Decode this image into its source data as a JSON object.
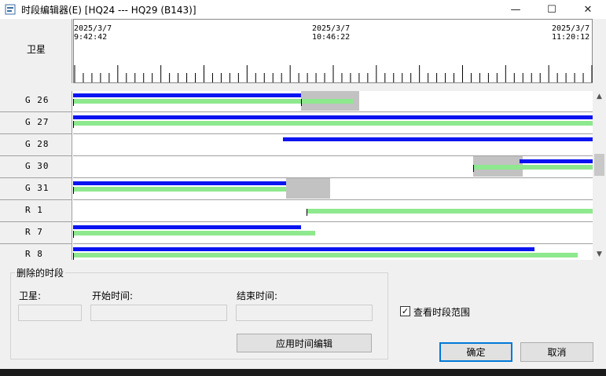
{
  "window": {
    "title": "时段编辑器(E) [HQ24 --- HQ29 (B143)]",
    "controls": {
      "minimize": "—",
      "maximize": "☐",
      "close": "✕"
    }
  },
  "header": {
    "satellite_column": "卫星"
  },
  "timeline": {
    "start": {
      "date": "2025/3/7",
      "time": "9:42:42"
    },
    "mid": {
      "date": "2025/3/7",
      "time": "10:46:22"
    },
    "end": {
      "date": "2025/3/7",
      "time": "11:20:12"
    }
  },
  "satellites": [
    {
      "label": "G 26",
      "blue": [
        [
          9.42,
          10.2
        ]
      ],
      "green": [
        [
          9.42,
          10.2
        ],
        [
          10.2,
          10.38
        ]
      ],
      "hatch": [
        [
          10.2,
          10.4
        ]
      ]
    },
    {
      "label": "G 27",
      "blue": [
        [
          9.42,
          11.2
        ]
      ],
      "green": [
        [
          9.42,
          11.2
        ]
      ],
      "hatch": []
    },
    {
      "label": "G 28",
      "blue": [
        [
          10.14,
          11.2
        ]
      ],
      "green": [],
      "hatch": []
    },
    {
      "label": "G 30",
      "blue": [
        [
          10.95,
          11.2
        ]
      ],
      "green": [
        [
          10.79,
          11.2
        ]
      ],
      "hatch": [
        [
          10.79,
          10.96
        ]
      ]
    },
    {
      "label": "G 31",
      "blue": [
        [
          9.42,
          10.15
        ]
      ],
      "green": [
        [
          9.42,
          10.15
        ]
      ],
      "hatch": [
        [
          10.15,
          10.3
        ]
      ]
    },
    {
      "label": "R 1",
      "blue": [],
      "green": [
        [
          10.22,
          11.2
        ]
      ],
      "hatch": []
    },
    {
      "label": "R 7",
      "blue": [
        [
          9.42,
          10.2
        ]
      ],
      "green": [
        [
          9.42,
          10.25
        ]
      ],
      "hatch": []
    },
    {
      "label": "R 8",
      "blue": [
        [
          9.42,
          11.0
        ]
      ],
      "green": [
        [
          9.42,
          11.15
        ]
      ],
      "hatch": []
    }
  ],
  "delete_panel": {
    "title": "删除的时段",
    "satellite_label": "卫星:",
    "start_label": "开始时间:",
    "end_label": "结束时间:",
    "satellite_value": "",
    "start_value": "",
    "end_value": "",
    "apply_button": "应用时间编辑"
  },
  "view_range": {
    "label": "查看时段范围",
    "checked": true
  },
  "buttons": {
    "ok": "确定",
    "cancel": "取消"
  },
  "colors": {
    "blue_segment": "#0a14f0",
    "green_segment": "#8ee88e",
    "focus": "#0078d7"
  }
}
